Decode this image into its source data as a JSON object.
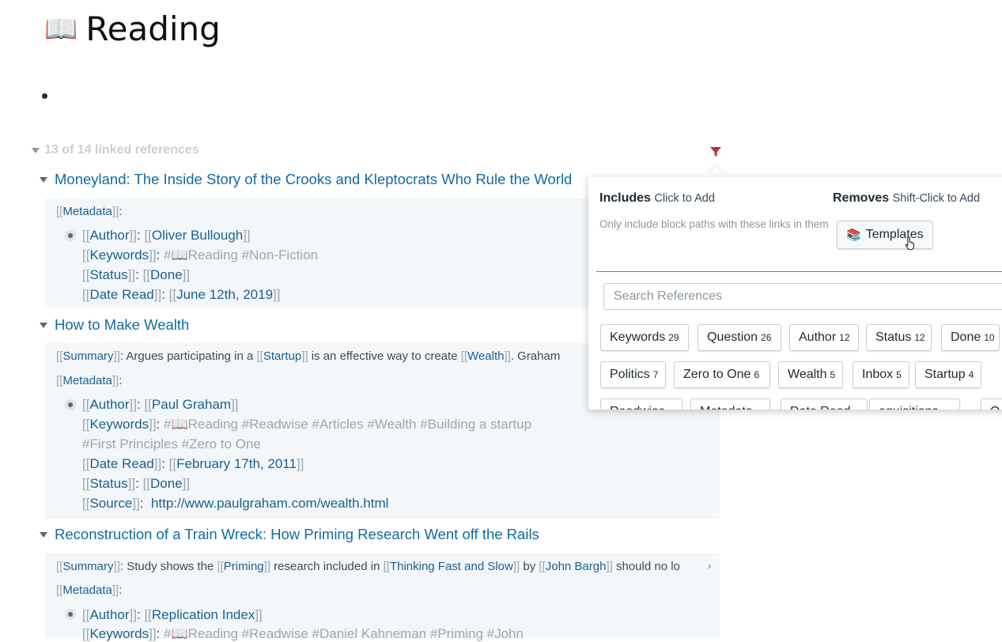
{
  "page": {
    "title": "Reading",
    "title_icon": "open-book-icon"
  },
  "linked_refs": {
    "header": "13 of 14 linked references"
  },
  "ref1": {
    "title": "Moneyland: The Inside Story of the Crooks and Kleptocrats Who Rule the World",
    "metadata": "Metadata",
    "author_key": "Author",
    "author_val": "Oliver Bullough",
    "keywords_key": "Keywords",
    "keywords_tags": "Reading #Non-Fiction",
    "status_key": "Status",
    "status_val": "Done",
    "dateread_key": "Date Read",
    "dateread_val": "June 12th, 2019"
  },
  "ref2": {
    "title": "How to Make Wealth",
    "summary_key": "Summary",
    "summary_text1": ": Argues participating in a ",
    "summary_link1": "Startup",
    "summary_text2": " is an effective way to create ",
    "summary_link2": "Wealth",
    "summary_text3": ". Graham",
    "metadata": "Metadata",
    "author_key": "Author",
    "author_val": "Paul Graham",
    "keywords_key": "Keywords",
    "keywords_tags": "Reading #Readwise #Articles #Wealth #Building a startup",
    "keywords_tags2": "#First Principles #Zero to One",
    "dateread_key": "Date Read",
    "dateread_val": "February 17th, 2011",
    "status_key": "Status",
    "status_val": "Done",
    "source_key": "Source",
    "source_val": "http://www.paulgraham.com/wealth.html"
  },
  "ref3": {
    "title": "Reconstruction of a Train Wreck: How Priming Research Went off the Rails",
    "summary_key": "Summary",
    "summary_text1": ": Study shows the ",
    "summary_link1": "Priming",
    "summary_text2": " research included in ",
    "summary_link2": "Thinking Fast and Slow",
    "summary_text3": " by ",
    "summary_link3": "John Bargh",
    "summary_text4": " should no lo",
    "metadata": "Metadata",
    "author_key": "Author",
    "author_val": "Replication Index",
    "keywords_key": "Keywords",
    "keywords_tags": "Reading #Readwise #Daniel Kahneman #Priming #John"
  },
  "filter_popover": {
    "includes_label": "Includes",
    "includes_hint": "Click to Add",
    "includes_desc": "Only include block paths with these links in them",
    "removes_label": "Removes",
    "removes_hint": "Shift-Click to Add",
    "removed_chip": "Templates",
    "search_placeholder": "Search References",
    "chips": [
      {
        "label": "Keywords",
        "count": "29"
      },
      {
        "label": "Question",
        "count": "26"
      },
      {
        "label": "Author",
        "count": "12"
      },
      {
        "label": "Status",
        "count": "12"
      },
      {
        "label": "Done",
        "count": "10"
      },
      {
        "label": "Politics",
        "count": "7"
      },
      {
        "label": "Zero to One",
        "count": "6"
      },
      {
        "label": "Wealth",
        "count": "5"
      },
      {
        "label": "Inbox",
        "count": "5"
      },
      {
        "label": "Startup",
        "count": "4"
      },
      {
        "label": "Readwise",
        "count": ""
      },
      {
        "label": "Metadata",
        "count": ""
      },
      {
        "label": "Date Read",
        "count": ""
      },
      {
        "label": "equisitions",
        "count": ""
      },
      {
        "label": "Q",
        "count": ""
      }
    ]
  },
  "colors": {
    "link": "#106ba3",
    "filter_icon": "#c23030",
    "card_bg": "#f3f7f9"
  }
}
